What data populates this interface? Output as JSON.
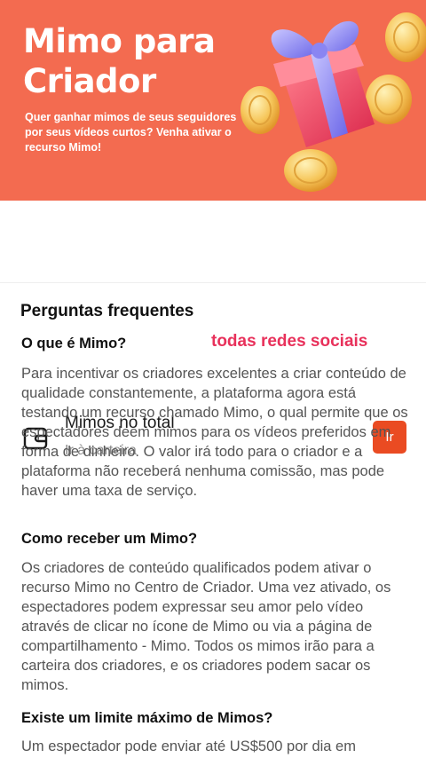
{
  "banner": {
    "title_line1": "Mimo para",
    "title_line2": "Criador",
    "subtitle": "Quer ganhar mimos de seus seguidores por seus vídeos curtos? Venha ativar o recurso Mimo!"
  },
  "wallet": {
    "title": "Mimos no total",
    "link": "Ir à carteira",
    "button": "Ir"
  },
  "faq": {
    "heading": "Perguntas frequentes",
    "overlay_text": "todas redes sociais",
    "items": [
      {
        "question": "O que é Mimo?",
        "answer": "Para incentivar os criadores excelentes a criar conteúdo de qualidade constantemente, a plataforma agora está testando um recurso chamado Mimo, o qual permite que os espectadores deem mimos para os vídeos preferidos em forma de dinheiro. O valor irá todo para o criador e a plataforma não receberá nenhuma comissão, mas pode haver uma taxa de serviço."
      },
      {
        "question": "Como receber um Mimo?",
        "answer": "Os criadores de conteúdo qualificados podem ativar o recurso Mimo no Centro de Criador. Uma vez ativado, os espectadores podem expressar seu amor pelo vídeo através de clicar no ícone de Mimo ou via a página de compartilhamento - Mimo. Todos os mimos irão para a carteira dos criadores, e os criadores podem sacar os mimos."
      },
      {
        "question": "Existe um limite máximo de Mimos?",
        "answer": "Um espectador pode enviar até US$500 por dia em"
      }
    ]
  },
  "colors": {
    "banner_bg": "#f36b50",
    "button_bg": "#ea4b22",
    "overlay_text": "#e8315b"
  }
}
